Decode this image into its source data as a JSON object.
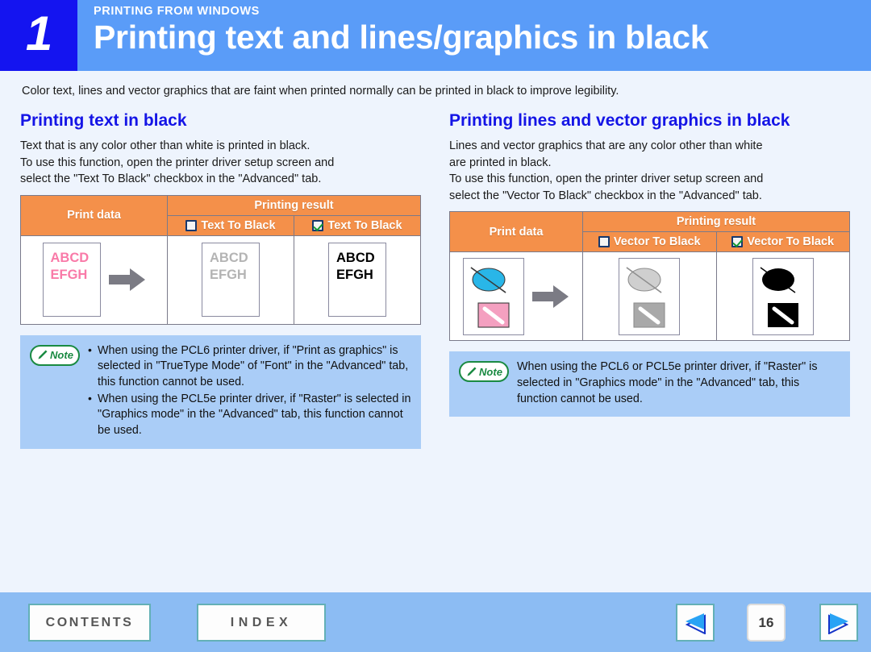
{
  "header": {
    "chapter_number": "1",
    "kicker": "PRINTING FROM WINDOWS",
    "title": "Printing text and lines/graphics in black",
    "badge_color": "#1414f0",
    "band_color": "#5a9cf8"
  },
  "intro": "Color text, lines and vector graphics that are faint when printed normally can be printed in black to improve legibility.",
  "left_section": {
    "title": "Printing text in black",
    "body_lines": [
      "Text that is any color other than white is printed in black.",
      "To use this function, open the printer driver setup screen and",
      "select the \"Text To Black\" checkbox in the \"Advanced\" tab."
    ],
    "table": {
      "header_print_data": "Print data",
      "header_printing_result": "Printing result",
      "col_unchecked_label": "Text To Black",
      "col_checked_label": "Text To Black",
      "samples": {
        "print_data": {
          "line1": "ABCD",
          "line2": "EFGH",
          "color": "#f97aa8"
        },
        "unchecked": {
          "line1": "ABCD",
          "line2": "EFGH",
          "color": "#b4b4b4"
        },
        "checked": {
          "line1": "ABCD",
          "line2": "EFGH",
          "color": "#000000"
        }
      },
      "header_bg": "#f4904a"
    },
    "note": {
      "badge_label": "Note",
      "items": [
        "When using the PCL6 printer driver, if \"Print as graphics\" is selected in \"TrueType Mode\" of \"Font\" in the \"Advanced\" tab, this function cannot be used.",
        "When using the PCL5e printer driver, if \"Raster\" is selected in \"Graphics mode\" in the \"Advanced\" tab, this function cannot be used."
      ]
    }
  },
  "right_section": {
    "title": "Printing lines and vector graphics in black",
    "body_lines": [
      "Lines and vector graphics that are any color other than white",
      "are printed in black.",
      "To use this function, open the printer driver setup screen and",
      "select the \"Vector To Black\" checkbox in the \"Advanced\" tab."
    ],
    "table": {
      "header_print_data": "Print data",
      "header_printing_result": "Printing result",
      "col_unchecked_label": "Vector To Black",
      "col_checked_label": "Vector To Black",
      "samples": {
        "print_data": {
          "ellipse_color": "#29b6e8",
          "square_color": "#f4a0c0"
        },
        "unchecked": {
          "ellipse_color": "#cfcfcf",
          "square_color": "#a9a9a9"
        },
        "checked": {
          "ellipse_color": "#000000",
          "square_color": "#000000"
        }
      },
      "header_bg": "#f4904a"
    },
    "note": {
      "badge_label": "Note",
      "items": [
        "When using the PCL6 or PCL5e printer driver, if \"Raster\" is selected in \"Graphics mode\" in the \"Advanced\" tab, this function cannot be used."
      ]
    }
  },
  "footer": {
    "contents_label": "CONTENTS",
    "index_label": "INDEX",
    "page_number": "16",
    "bar_color": "#8cbcf3",
    "nav_arrow_color": "#29a3f5"
  }
}
